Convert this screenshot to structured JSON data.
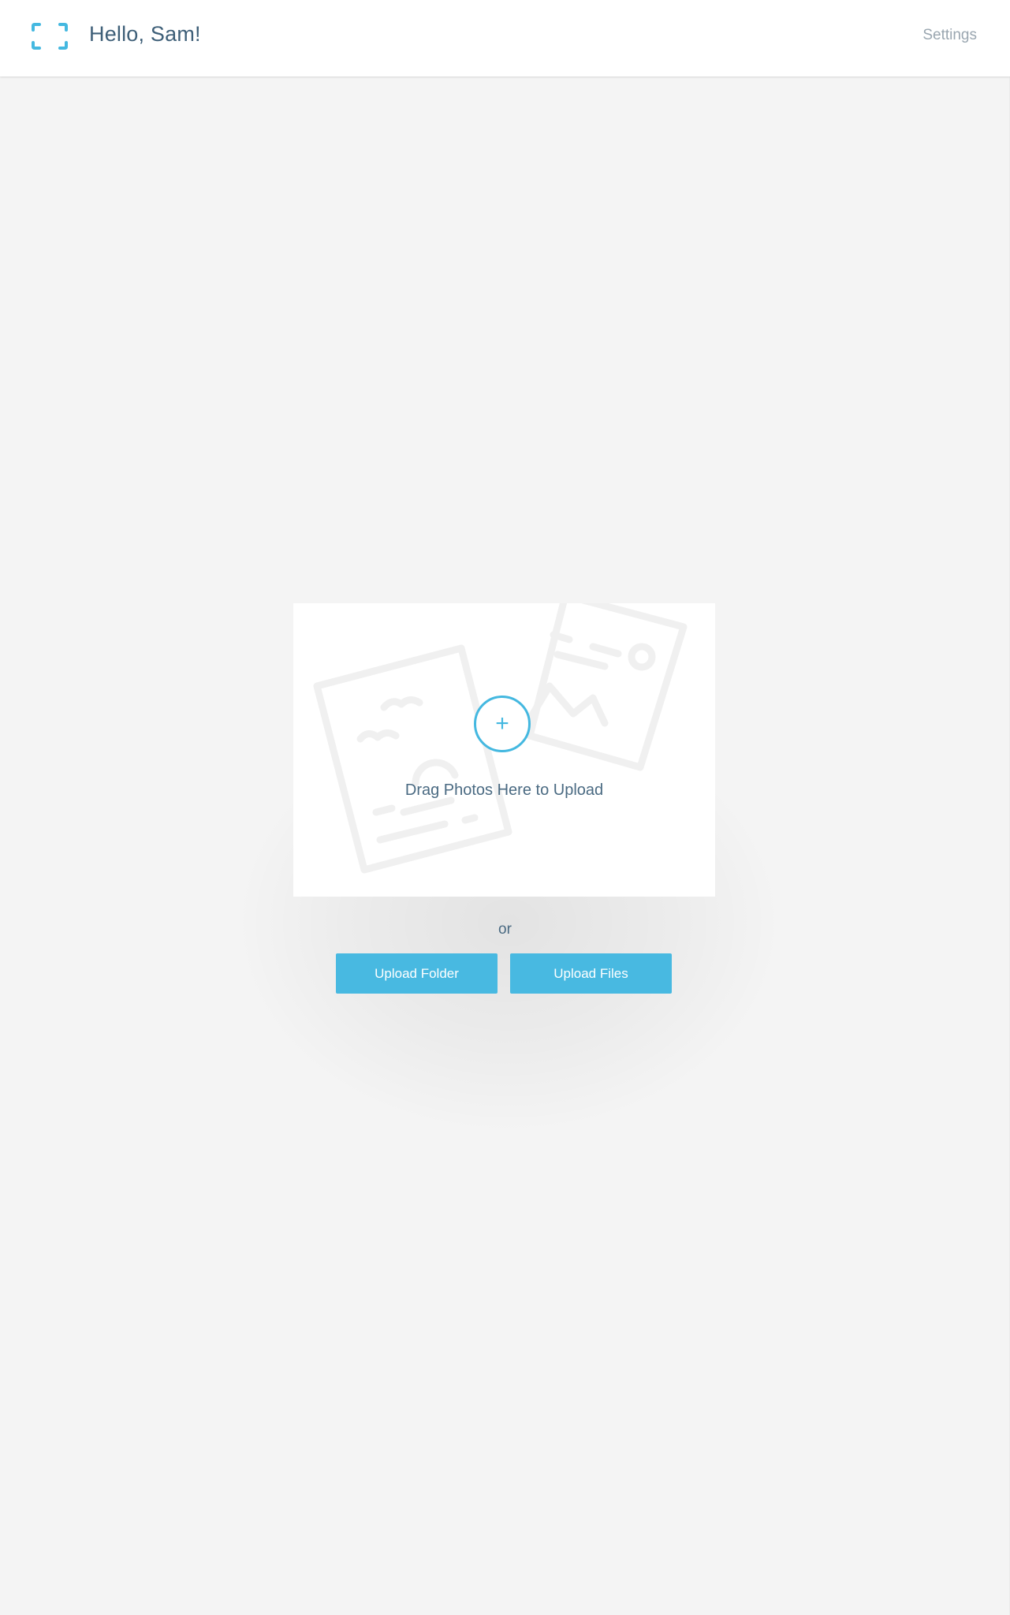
{
  "header": {
    "logo_icon": "frame-corners-icon",
    "greeting": "Hello, Sam!",
    "settings_label": "Settings"
  },
  "dropzone": {
    "plus_icon": "plus-icon",
    "plus_symbol": "+",
    "instruction": "Drag Photos Here to Upload",
    "background_icons": [
      "photo-postcard-icon",
      "landscape-photo-icon"
    ]
  },
  "separator_text": "or",
  "actions": {
    "upload_folder_label": "Upload Folder",
    "upload_files_label": "Upload Files"
  },
  "colors": {
    "accent": "#48b9e1",
    "text_primary": "#3e5f78",
    "text_muted": "#9aa6b0",
    "background": "#f4f4f4"
  }
}
